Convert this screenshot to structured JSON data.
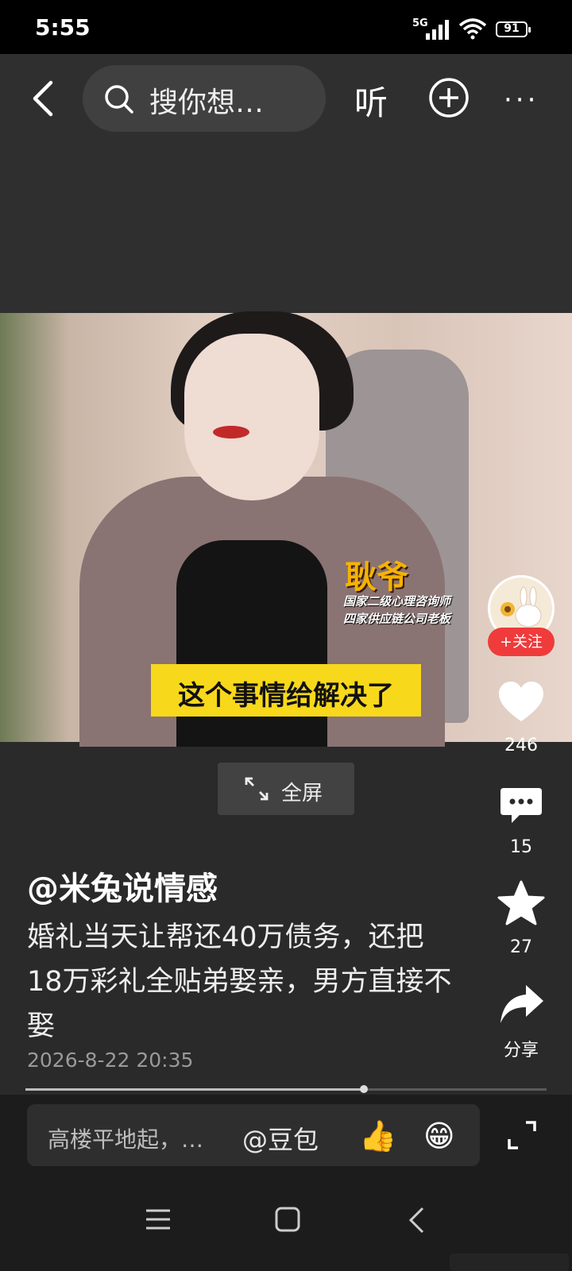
{
  "status_bar": {
    "time": "5:55",
    "network": "5G",
    "battery": "91"
  },
  "top_bar": {
    "search_placeholder": "搜你想…",
    "listen_label": "听"
  },
  "video": {
    "name_tag": "耿爷",
    "title_line1": "国家二级心理咨询师",
    "title_line2": "四家供应链公司老板",
    "caption": "这个事情给解决了",
    "fullscreen_label": "全屏"
  },
  "actions": {
    "follow_label": "+关注",
    "likes": "246",
    "comments": "15",
    "favorites": "27",
    "share_label": "分享"
  },
  "post": {
    "author": "@米兔说情感",
    "description": "婚礼当天让帮还40万债务，还把18万彩礼全贴弟娶亲，男方直接不娶",
    "date": "2026-8-22 20:35",
    "progress": 0.65
  },
  "comment_bar": {
    "placeholder": "高楼平地起，…",
    "mention": "@豆包",
    "emoji_thumbs": "👍",
    "emoji_grin": "😁"
  },
  "icons": [
    "back-icon",
    "search-icon",
    "plus-icon",
    "more-icon",
    "heart-icon",
    "comment-icon",
    "star-icon",
    "share-icon",
    "expand-icon",
    "nav-menu-icon",
    "nav-home-icon",
    "nav-back-icon"
  ]
}
